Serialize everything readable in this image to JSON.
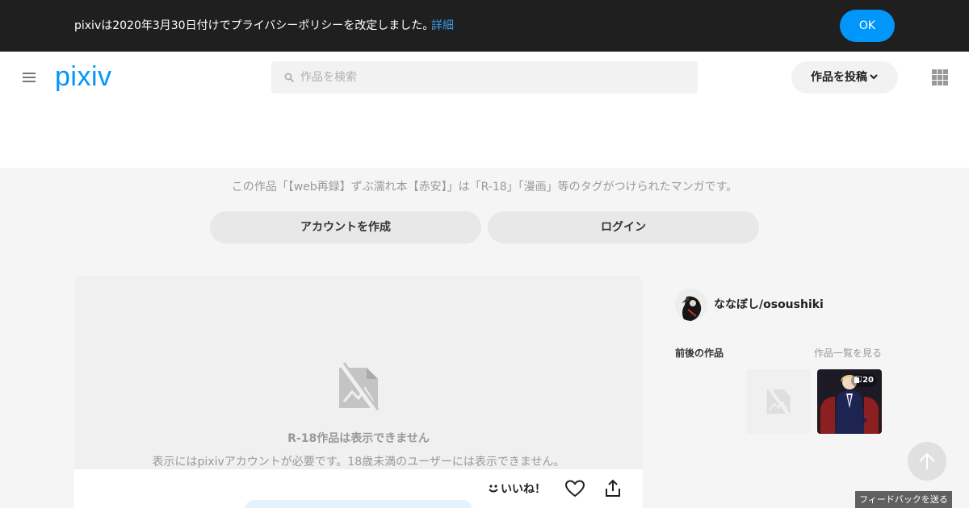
{
  "notice": {
    "text": "pixivは2020年3月30日付けでプライバシーポリシーを改定しました。",
    "link": "詳細",
    "ok": "OK"
  },
  "header": {
    "logo": "pixiv",
    "search_placeholder": "作品を検索",
    "post_button": "作品を投稿"
  },
  "r18_banner": {
    "text": "この作品「【web再録】ずぶ濡れ本【赤安】」は「R-18」「漫画」等のタグがつけられたマンガです。",
    "create_account": "アカウントを作成",
    "login": "ログイン"
  },
  "artwork": {
    "restricted_title": "R-18作品は表示できません",
    "restricted_desc": "表示にはpixivアカウントが必要です。18歳未満のユーザーには表示できません。",
    "like_label": "いいね！"
  },
  "sidebar": {
    "author_name": "ななぼし/osoushiki",
    "works_heading": "前後の作品",
    "works_link": "作品一覧を見る",
    "page_count": "20"
  },
  "feedback": "フィードバックを送る",
  "colors": {
    "brand": "#0096fa",
    "notice_bg": "#1f1f1f",
    "link": "#3d9ae6"
  }
}
